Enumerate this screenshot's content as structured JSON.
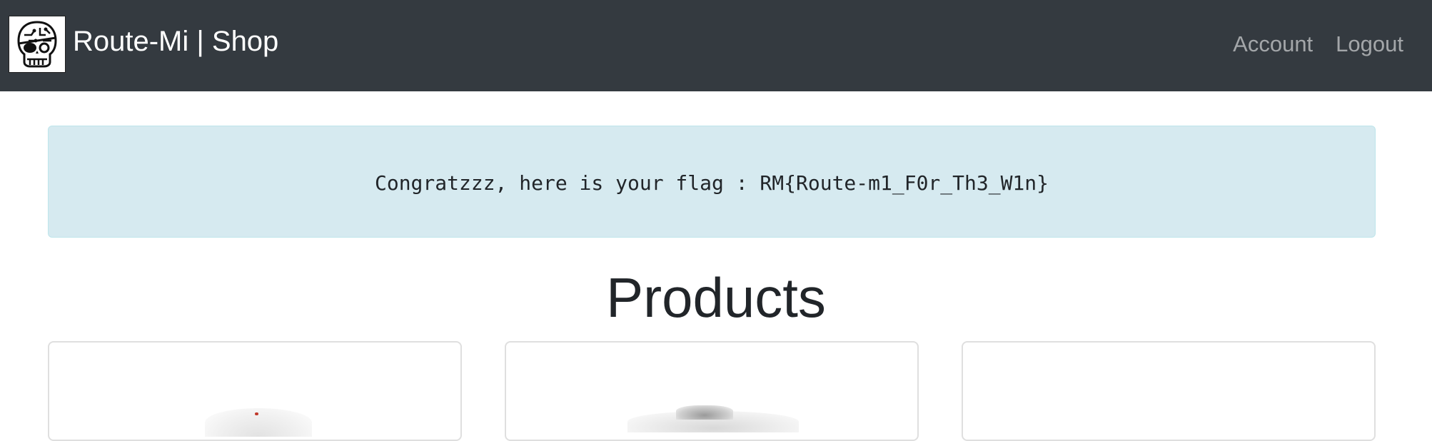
{
  "navbar": {
    "brand_text": "Route-Mi | Shop",
    "logo_icon": "skull-eyepatch-icon",
    "links": [
      "Account",
      "Logout"
    ],
    "background": "#343a40"
  },
  "alert": {
    "message": "Congratzzz, here is your flag : RM{Route-m1_F0r_Th3_W1n}",
    "background": "#d6eaf0"
  },
  "main": {
    "title": "Products"
  },
  "products": [
    {
      "image_icon": "product-image"
    },
    {
      "image_icon": "product-image"
    },
    {
      "image_icon": "product-image"
    }
  ]
}
